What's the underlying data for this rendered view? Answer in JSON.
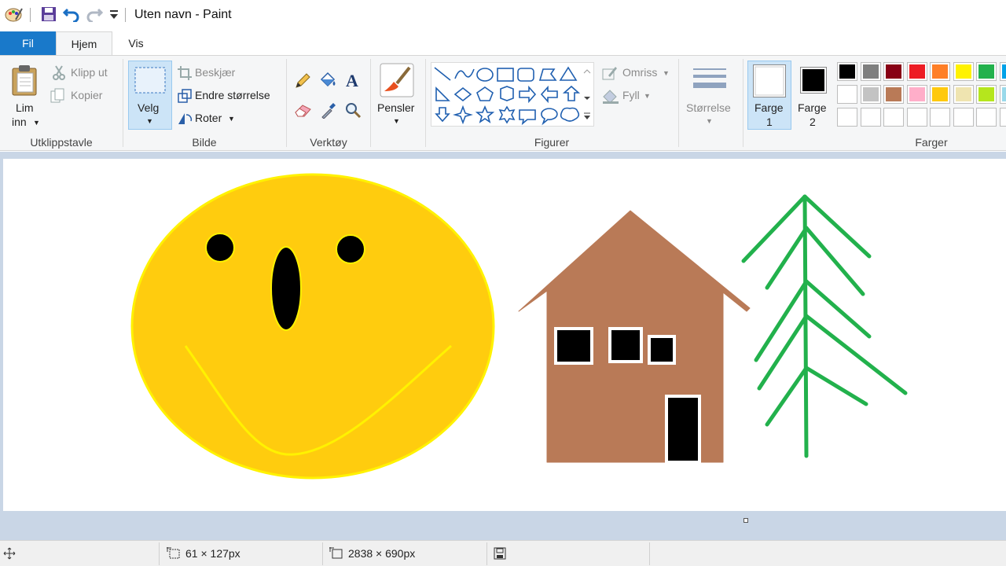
{
  "window": {
    "title": "Uten navn - Paint"
  },
  "tabs": {
    "file": "Fil",
    "home": "Hjem",
    "view": "Vis"
  },
  "clipboard": {
    "paste_line1": "Lim",
    "paste_line2": "inn",
    "cut": "Klipp ut",
    "copy": "Kopier",
    "group": "Utklippstavle"
  },
  "image": {
    "select": "Velg",
    "crop": "Beskjær",
    "resize": "Endre størrelse",
    "rotate": "Roter",
    "group": "Bilde"
  },
  "tools": {
    "group": "Verktøy"
  },
  "brushes": {
    "label": "Pensler"
  },
  "shapes": {
    "outline": "Omriss",
    "fill": "Fyll",
    "group": "Figurer"
  },
  "size": {
    "label": "Størrelse"
  },
  "colors": {
    "color1_line1": "Farge",
    "color1_line2": "1",
    "color2_line1": "Farge",
    "color2_line2": "2",
    "group": "Farger",
    "color1_value": "#ffffff",
    "color2_value": "#000000",
    "palette_row1": [
      "#000000",
      "#7f7f7f",
      "#880015",
      "#ed1c24",
      "#ff7f27",
      "#fff200",
      "#22b14c",
      "#00a2e8"
    ],
    "palette_row2": [
      "#ffffff",
      "#c3c3c3",
      "#b97a57",
      "#ffaec9",
      "#ffc90e",
      "#efe4b0",
      "#b5e61d",
      "#99d9ea"
    ],
    "palette_row3": [
      "",
      "",
      "",
      "",
      "",
      "",
      "",
      ""
    ]
  },
  "status": {
    "selection_size": "61 × 127px",
    "canvas_size": "2838 × 690px"
  },
  "drawing": {
    "face_color": "#ffcc0e",
    "face_outline": "#fff200",
    "house_color": "#b97a57",
    "tree_color": "#22b14c"
  }
}
